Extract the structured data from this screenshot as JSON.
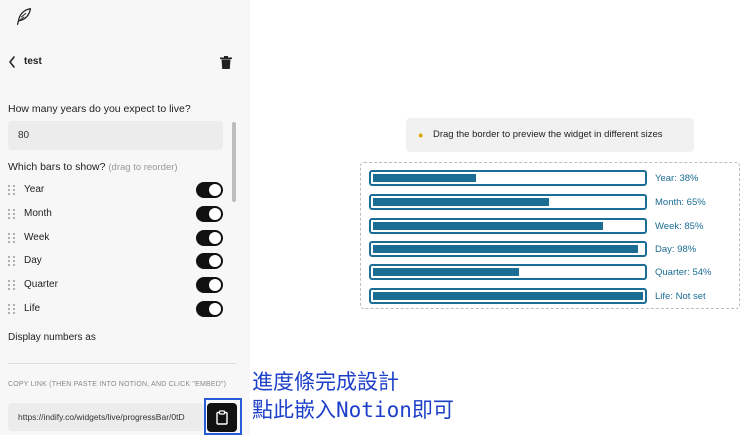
{
  "header": {
    "logo_icon": "feather-icon",
    "back_icon": "chevron-left-icon",
    "title": "test",
    "delete_icon": "trash-icon"
  },
  "form": {
    "years_label": "How many years do you expect to live?",
    "years_value": "80",
    "bars_label": "Which bars to show?",
    "bars_hint": "(drag to reorder)",
    "bars": [
      {
        "label": "Year",
        "enabled": true
      },
      {
        "label": "Month",
        "enabled": true
      },
      {
        "label": "Week",
        "enabled": true
      },
      {
        "label": "Day",
        "enabled": true
      },
      {
        "label": "Quarter",
        "enabled": true
      },
      {
        "label": "Life",
        "enabled": true
      }
    ],
    "display_label": "Display numbers as",
    "copy_label": "COPY LINK (THEN PASTE INTO NOTION, AND CLICK \"EMBED\")",
    "link_value": "https://indify.co/widgets/live/progressBar/0tD",
    "copy_icon": "clipboard-icon"
  },
  "preview": {
    "tip_icon": "lightbulb-icon",
    "tip_text": "Drag the border to preview the widget in different sizes",
    "bar_color": "#1b6d94",
    "bars": [
      {
        "label": "Year: 38%",
        "progress": 38
      },
      {
        "label": "Month: 65%",
        "progress": 65
      },
      {
        "label": "Week: 85%",
        "progress": 85
      },
      {
        "label": "Day: 98%",
        "progress": 98
      },
      {
        "label": "Quarter: 54%",
        "progress": 54
      },
      {
        "label": "Life: Not set",
        "progress": 100
      }
    ]
  },
  "annotation": {
    "line1": "進度條完成設計",
    "line2": "點此嵌入Notion即可",
    "color": "#1e40c8"
  }
}
